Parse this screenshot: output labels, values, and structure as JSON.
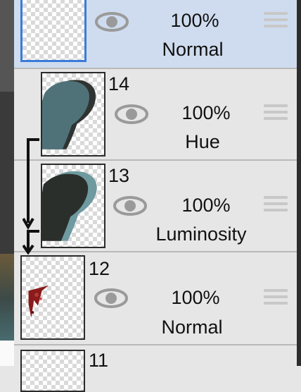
{
  "layers": [
    {
      "number": "",
      "opacity": "100%",
      "blend": "Normal",
      "selected": true,
      "clipped": false,
      "thumb": "empty"
    },
    {
      "number": "14",
      "opacity": "100%",
      "blend": "Hue",
      "selected": false,
      "clipped": true,
      "thumb": "teal-shape"
    },
    {
      "number": "13",
      "opacity": "100%",
      "blend": "Luminosity",
      "selected": false,
      "clipped": true,
      "thumb": "dark-shape"
    },
    {
      "number": "12",
      "opacity": "100%",
      "blend": "Normal",
      "selected": false,
      "clipped": false,
      "thumb": "red-splatter"
    },
    {
      "number": "11",
      "opacity": "",
      "blend": "",
      "selected": false,
      "clipped": false,
      "thumb": "empty"
    }
  ],
  "icons": {
    "visibility": "eye-icon",
    "handle": "drag-handle-icon",
    "clip": "clipping-arrow-icon"
  },
  "colors": {
    "selected_bg": "#cfdcef",
    "row_bg": "#e6e6e6",
    "selection_border": "#3b7bd8"
  }
}
